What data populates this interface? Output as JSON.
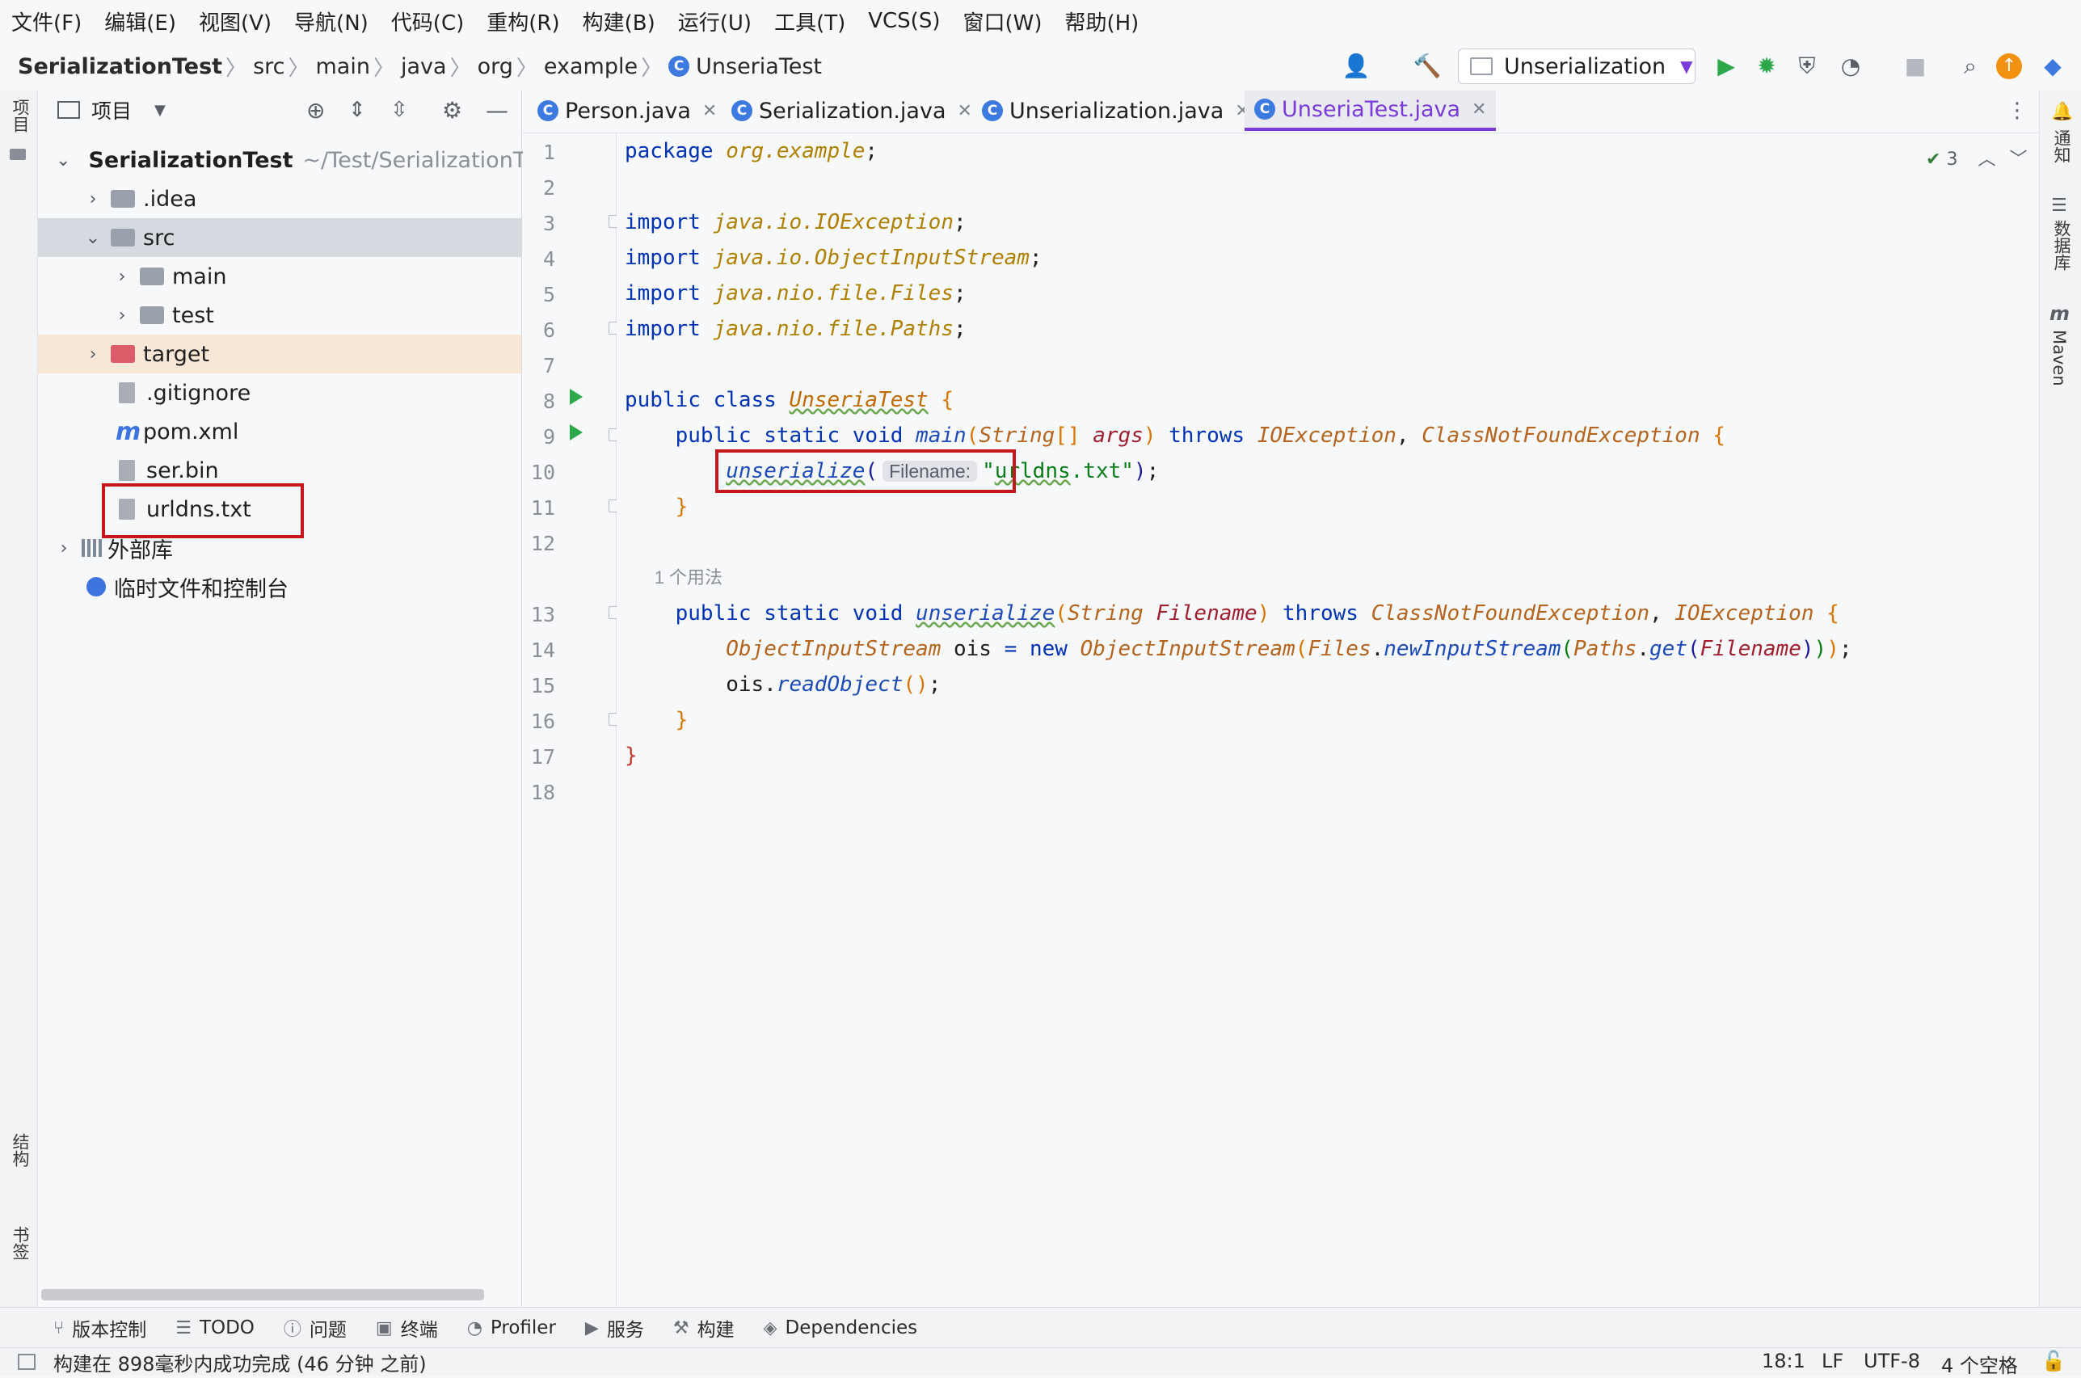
{
  "menu": [
    "文件(F)",
    "编辑(E)",
    "视图(V)",
    "导航(N)",
    "代码(C)",
    "重构(R)",
    "构建(B)",
    "运行(U)",
    "工具(T)",
    "VCS(S)",
    "窗口(W)",
    "帮助(H)"
  ],
  "breadcrumb": [
    "SerializationTest",
    "src",
    "main",
    "java",
    "org",
    "example",
    "UnseriaTest"
  ],
  "run_config": "Unserialization",
  "left_stripe": {
    "project": "项目",
    "structure": "结构",
    "bookmarks": "书签"
  },
  "right_stripe": {
    "notifications": "通知",
    "database": "数据库",
    "maven": "Maven"
  },
  "project_panel": {
    "title": "项目",
    "tree": [
      {
        "label": "SerializationTest",
        "path": "~/Test/SerializationTes"
      },
      {
        "label": ".idea"
      },
      {
        "label": "src"
      },
      {
        "label": "main"
      },
      {
        "label": "test"
      },
      {
        "label": "target"
      },
      {
        "label": ".gitignore"
      },
      {
        "label": "pom.xml"
      },
      {
        "label": "ser.bin"
      },
      {
        "label": "urldns.txt"
      },
      {
        "label": "外部库"
      },
      {
        "label": "临时文件和控制台"
      }
    ]
  },
  "tabs": [
    "Person.java",
    "Serialization.java",
    "Unserialization.java",
    "UnseriaTest.java"
  ],
  "editor": {
    "inspection_count": "3",
    "usage_hint": "1 个用法",
    "param_hint": "Filename:",
    "line_numbers": [
      "1",
      "2",
      "3",
      "4",
      "5",
      "6",
      "7",
      "8",
      "9",
      "10",
      "11",
      "12",
      "13",
      "14",
      "15",
      "16",
      "17",
      "18"
    ]
  },
  "tool_windows": [
    "版本控制",
    "TODO",
    "问题",
    "终端",
    "Profiler",
    "服务",
    "构建",
    "Dependencies"
  ],
  "status": {
    "message": "构建在 898毫秒内成功完成 (46 分钟 之前)",
    "position": "18:1",
    "line_sep": "LF",
    "encoding": "UTF-8",
    "indent": "4 个空格"
  }
}
